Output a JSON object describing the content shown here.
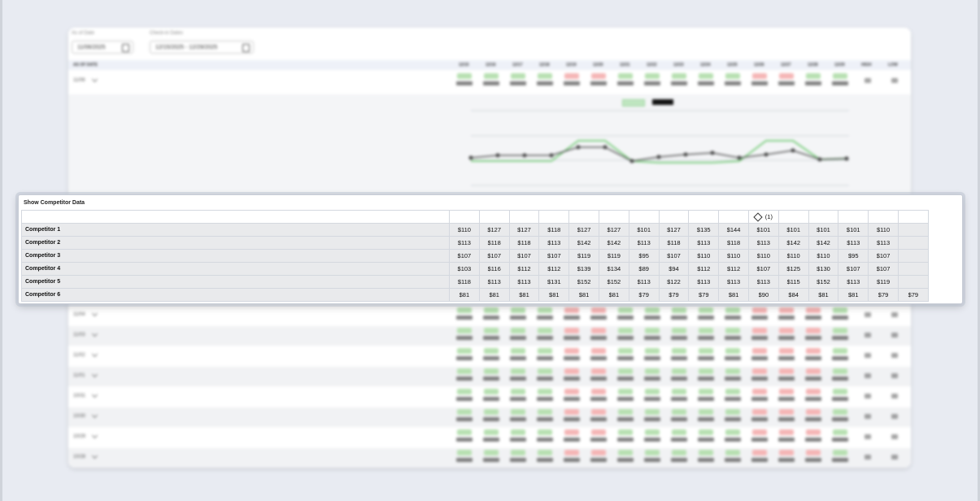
{
  "background": {
    "filters": {
      "as_of_label": "As of Date",
      "as_of_value": "11/06/2025",
      "checkin_label": "Check-in Dates",
      "checkin_value": "12/15/2025 - 12/29/2025"
    },
    "header": {
      "first_col": "AS OF DATE",
      "date_cols": [
        "12/15",
        "12/16",
        "12/17",
        "12/18",
        "12/19",
        "12/20",
        "12/21",
        "12/22",
        "12/23",
        "12/24",
        "12/25",
        "12/26",
        "12/27",
        "12/28",
        "12/29"
      ],
      "high": "HIGH",
      "low": "LOW"
    },
    "top_row_label": "11/06",
    "bottom_row_labels": [
      "11/04",
      "11/03",
      "11/02",
      "11/01",
      "10/31",
      "10/30",
      "10/29",
      "10/28"
    ]
  },
  "competitor_panel": {
    "title": "Show Competitor Data",
    "pinned_count": "(1)",
    "rows": [
      {
        "name": "Competitor 1",
        "values": [
          "$110",
          "$127",
          "$127",
          "$118",
          "$127",
          "$127",
          "$101",
          "$127",
          "$135",
          "$144",
          "$101",
          "$101",
          "$101",
          "$101",
          "$110"
        ]
      },
      {
        "name": "Competitor 2",
        "values": [
          "$113",
          "$118",
          "$118",
          "$113",
          "$142",
          "$142",
          "$113",
          "$118",
          "$113",
          "$118",
          "$113",
          "$142",
          "$142",
          "$113",
          "$113"
        ]
      },
      {
        "name": "Competitor 3",
        "values": [
          "$107",
          "$107",
          "$107",
          "$107",
          "$119",
          "$119",
          "$95",
          "$107",
          "$110",
          "$110",
          "$110",
          "$110",
          "$110",
          "$95",
          "$107"
        ]
      },
      {
        "name": "Competitor 4",
        "values": [
          "$103",
          "$116",
          "$112",
          "$112",
          "$139",
          "$134",
          "$89",
          "$94",
          "$112",
          "$112",
          "$107",
          "$125",
          "$130",
          "$107",
          "$107"
        ]
      },
      {
        "name": "Competitor 5",
        "values": [
          "$118",
          "$113",
          "$113",
          "$131",
          "$152",
          "$152",
          "$113",
          "$122",
          "$113",
          "$113",
          "$113",
          "$115",
          "$152",
          "$113",
          "$119"
        ]
      },
      {
        "name": "Competitor 6",
        "values": [
          "$81",
          "$81",
          "$81",
          "$81",
          "$81",
          "$81",
          "$79",
          "$79",
          "$79",
          "$81",
          "$90",
          "$84",
          "$81",
          "$81",
          "$79",
          "$79"
        ]
      }
    ]
  }
}
